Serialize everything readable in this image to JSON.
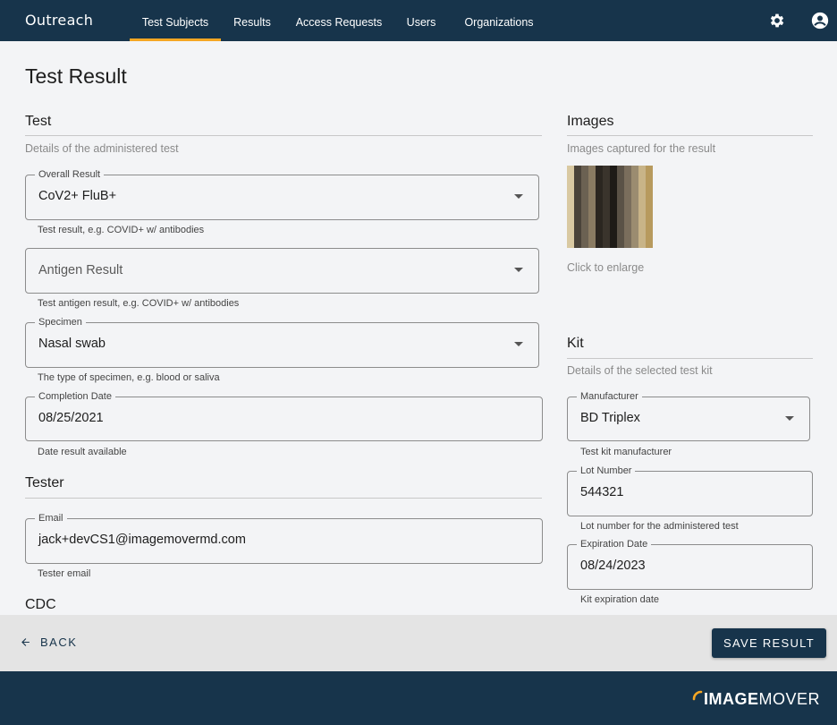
{
  "nav": {
    "brand": "Outreach",
    "tabs": [
      {
        "label": "Test Subjects",
        "active": true
      },
      {
        "label": "Results",
        "active": false
      },
      {
        "label": "Access Requests",
        "active": false
      },
      {
        "label": "Users",
        "active": false
      },
      {
        "label": "Organizations",
        "active": false
      }
    ],
    "icons": [
      "gear-icon",
      "account-icon"
    ]
  },
  "page": {
    "title": "Test Result"
  },
  "test": {
    "title": "Test",
    "subtitle": "Details of the administered test",
    "overall_result": {
      "label": "Overall Result",
      "value": "CoV2+ FluB+",
      "helper": "Test result, e.g. COVID+ w/ antibodies"
    },
    "antigen_result": {
      "placeholder": "Antigen Result",
      "helper": "Test antigen result, e.g. COVID+ w/ antibodies"
    },
    "specimen": {
      "label": "Specimen",
      "value": "Nasal swab",
      "helper": "The type of specimen, e.g. blood or saliva"
    },
    "completion_date": {
      "label": "Completion Date",
      "value": "08/25/2021",
      "helper": "Date result available"
    }
  },
  "tester": {
    "title": "Tester",
    "email": {
      "label": "Email",
      "value": "jack+devCS1@imagemovermd.com",
      "helper": "Tester email"
    }
  },
  "cdc": {
    "title": "CDC"
  },
  "images": {
    "title": "Images",
    "subtitle": "Images captured for the result",
    "caption": "Click to enlarge"
  },
  "kit": {
    "title": "Kit",
    "subtitle": "Details of the selected test kit",
    "manufacturer": {
      "label": "Manufacturer",
      "value": "BD Triplex",
      "helper": "Test kit manufacturer"
    },
    "lot_number": {
      "label": "Lot Number",
      "value": "544321",
      "helper": "Lot number for the administered test"
    },
    "expiration_date": {
      "label": "Expiration Date",
      "value": "08/24/2023",
      "helper": "Kit expiration date"
    }
  },
  "actions": {
    "back_label": "BACK",
    "save_label": "SAVE RESULT"
  },
  "footer": {
    "logo_bold": "IMAGE",
    "logo_light": "MOVER"
  },
  "colors": {
    "nav_bg": "#17344b",
    "accent": "#f5a623",
    "action_bar": "#e4e4e4"
  }
}
